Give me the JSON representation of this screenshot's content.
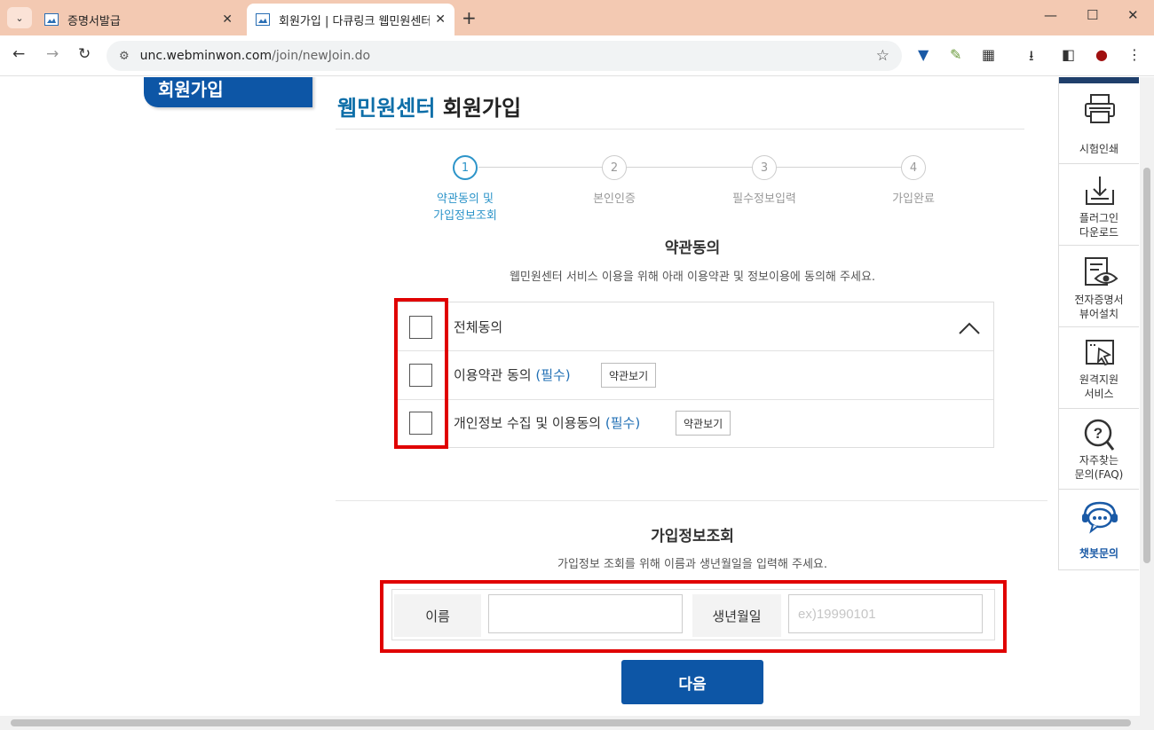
{
  "browser": {
    "tabs": [
      {
        "title": "증명서발급",
        "active": false
      },
      {
        "title": "회원가입 | 다큐링크 웹민원센터",
        "active": true
      }
    ],
    "new_tab": "+",
    "url_host": "unc.webminwon.com",
    "url_path": "/join/newJoin.do",
    "icons": [
      "tab-list-icon",
      "back-icon",
      "forward-icon",
      "reload-icon",
      "site-settings-icon",
      "bookmark-star-icon",
      "extension-shield-icon",
      "extension-pen-icon",
      "extensions-puzzle-icon",
      "download-icon",
      "sidebar-icon",
      "profile-icon",
      "menu-kebab-icon"
    ]
  },
  "page": {
    "side_tab": "회원가입",
    "title_brand": "웹민원센터",
    "title_rest": " 회원가입",
    "steps": [
      {
        "num": "1",
        "label": "약관동의 및\n가입정보조회",
        "active": true
      },
      {
        "num": "2",
        "label": "본인인증",
        "active": false
      },
      {
        "num": "3",
        "label": "필수정보입력",
        "active": false
      },
      {
        "num": "4",
        "label": "가입완료",
        "active": false
      }
    ],
    "agree": {
      "title": "약관동의",
      "desc": "웹민원센터 서비스 이용을 위해 아래 이용약관 및 정보이용에 동의해 주세요.",
      "all_label": "전체동의",
      "rows": [
        {
          "label": "이용약관 동의 ",
          "req": "(필수)",
          "button": "약관보기"
        },
        {
          "label": "개인정보 수집 및 이용동의 ",
          "req": "(필수)",
          "button": "약관보기"
        }
      ]
    },
    "lookup": {
      "title": "가입정보조회",
      "desc": "가입정보 조회를 위해 이름과 생년월일을 입력해 주세요.",
      "name_label": "이름",
      "name_value": "",
      "birth_label": "생년월일",
      "birth_placeholder": "ex)19990101"
    },
    "next_button": "다음"
  },
  "quick_menu": [
    {
      "label": "시험인쇄",
      "icon": "printer-icon"
    },
    {
      "label": "플러그인\n다운로드",
      "icon": "download-tray-icon"
    },
    {
      "label": "전자증명서\n뷰어설치",
      "icon": "document-eye-icon"
    },
    {
      "label": "원격지원\n서비스",
      "icon": "remote-cursor-icon"
    },
    {
      "label": "자주찾는\n문의(FAQ)",
      "icon": "question-magnifier-icon"
    },
    {
      "label": "챗봇문의",
      "icon": "chatbot-icon"
    }
  ],
  "colors": {
    "accent_blue": "#0d56a6",
    "step_active": "#2c94c9",
    "highlight_red": "#e00000",
    "required_blue": "#2270b5"
  }
}
